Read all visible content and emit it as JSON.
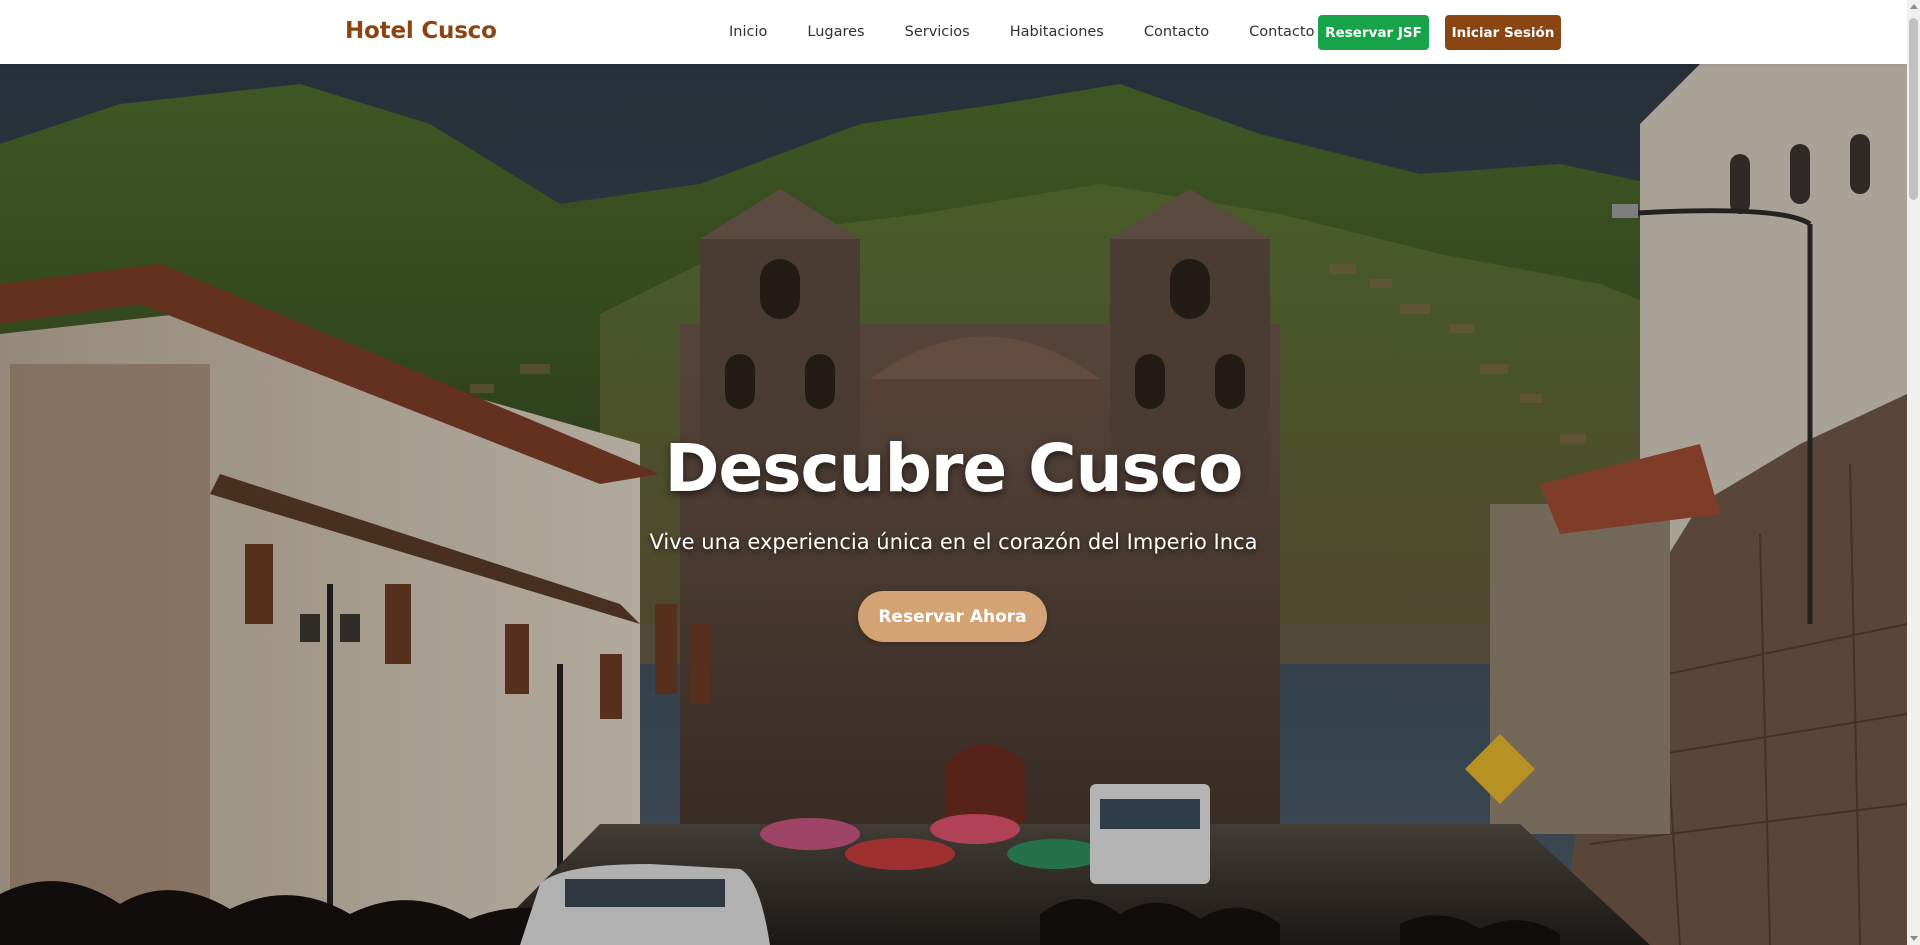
{
  "header": {
    "brand": "Hotel Cusco",
    "nav": [
      {
        "label": "Inicio",
        "name": "nav-link-inicio"
      },
      {
        "label": "Lugares",
        "name": "nav-link-lugares"
      },
      {
        "label": "Servicios",
        "name": "nav-link-servicios"
      },
      {
        "label": "Habitaciones",
        "name": "nav-link-habitaciones"
      },
      {
        "label": "Contacto",
        "name": "nav-link-contacto"
      },
      {
        "label": "Contacto JSF",
        "name": "nav-link-contacto-jsf"
      }
    ],
    "reserve_jsf_label": "Reservar JSF",
    "login_label": "Iniciar Sesión"
  },
  "hero": {
    "title": "Descubre Cusco",
    "subtitle": "Vive una experiencia única en el corazón del Imperio Inca",
    "cta_label": "Reservar Ahora",
    "background_image": "cusco-street-cathedral-mountains-photo"
  },
  "colors": {
    "brand": "#8b4513",
    "reserve_button": "#16a34a",
    "login_button": "#8b4513",
    "cta_button": "#d4a373"
  }
}
